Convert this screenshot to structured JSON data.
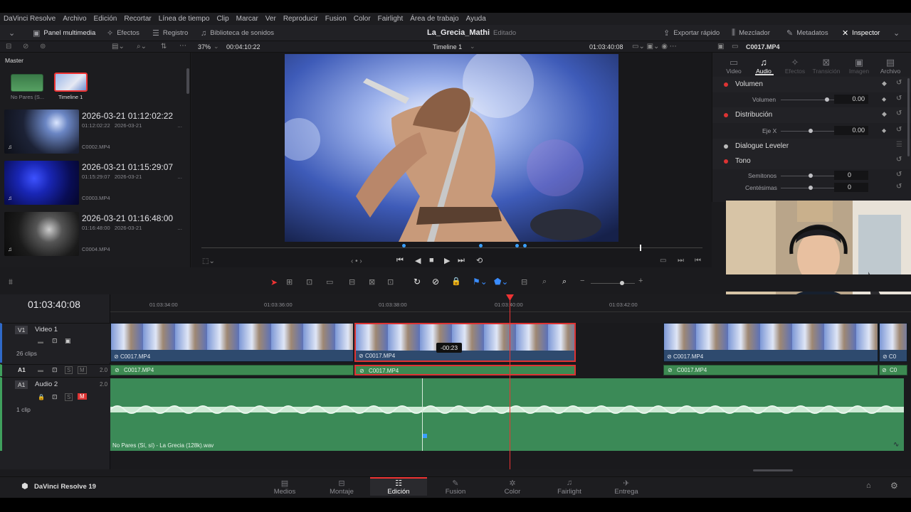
{
  "menu": [
    "DaVinci Resolve",
    "Archivo",
    "Edición",
    "Recortar",
    "Línea de tiempo",
    "Clip",
    "Marcar",
    "Ver",
    "Reproducir",
    "Fusion",
    "Color",
    "Fairlight",
    "Área de trabajo",
    "Ayuda"
  ],
  "toolbar": {
    "media_pool": "Panel multimedia",
    "effects": "Efectos",
    "edit_index": "Registro",
    "sound_library": "Biblioteca de sonidos",
    "project_title": "La_Grecia_Mathi",
    "project_state": "Editado",
    "quick_export": "Exportar rápido",
    "mixer": "Mezclador",
    "metadata": "Metadatos",
    "inspector": "Inspector"
  },
  "viewer_bar": {
    "zoom": "37%",
    "source_tc": "00:04:10:22",
    "timeline_name": "Timeline 1",
    "record_tc": "01:03:40:08",
    "clip_name": "C0017.MP4"
  },
  "media_pool": {
    "bin": "Master",
    "bin_items": [
      {
        "label": "No Pares (S..."
      },
      {
        "label": "Timeline 1"
      }
    ],
    "clips": [
      {
        "date": "2026-03-21  01:12:02:22",
        "tc": "01:12:02:22",
        "day": "2026-03-21",
        "name": "C0002.MP4"
      },
      {
        "date": "2026-03-21  01:15:29:07",
        "tc": "01:15:29:07",
        "day": "2026-03-21",
        "name": "C0003.MP4"
      },
      {
        "date": "2026-03-21  01:16:48:00",
        "tc": "01:16:48:00",
        "day": "2026-03-21",
        "name": "C0004.MP4"
      }
    ]
  },
  "inspector": {
    "tabs": [
      "Video",
      "Audio",
      "Efectos",
      "Transición",
      "Imagen",
      "Archivo"
    ],
    "sections": {
      "volume": "Volumen",
      "volume_param": "Volumen",
      "volume_value": "0.00",
      "pan": "Distribución",
      "pan_param": "Eje X",
      "pan_value": "0.00",
      "leveler": "Dialogue Leveler",
      "pitch": "Tono",
      "semitones": "Semitonos",
      "semitones_value": "0",
      "cents": "Centésimas",
      "cents_value": "0"
    }
  },
  "timeline": {
    "timecode": "01:03:40:08",
    "ruler": [
      "01:03:34:00",
      "01:03:36:00",
      "01:03:38:00",
      "01:03:40:00",
      "01:03:42:00"
    ],
    "v1": {
      "badge": "V1",
      "name": "Video 1",
      "count": "26 clips"
    },
    "a1": {
      "badge": "A1",
      "level": "2.0"
    },
    "a2": {
      "badge": "A1",
      "name": "Audio 2",
      "level": "2.0",
      "count": "1 clip"
    },
    "clip_name": "C0017.MP4",
    "trim_tooltip": "-00:23",
    "audio_file": "No Pares (Sí, sí) - La Grecia (128k).wav"
  },
  "brand": "DaVinci Resolve 19",
  "pages": [
    "Medios",
    "Montaje",
    "Edición",
    "Fusion",
    "Color",
    "Fairlight",
    "Entrega"
  ],
  "colors": {
    "accent_red": "#e33333",
    "clip_blue": "#2e4a6e",
    "audio_green": "#3d8a52",
    "active_tab": "#ffffff"
  }
}
